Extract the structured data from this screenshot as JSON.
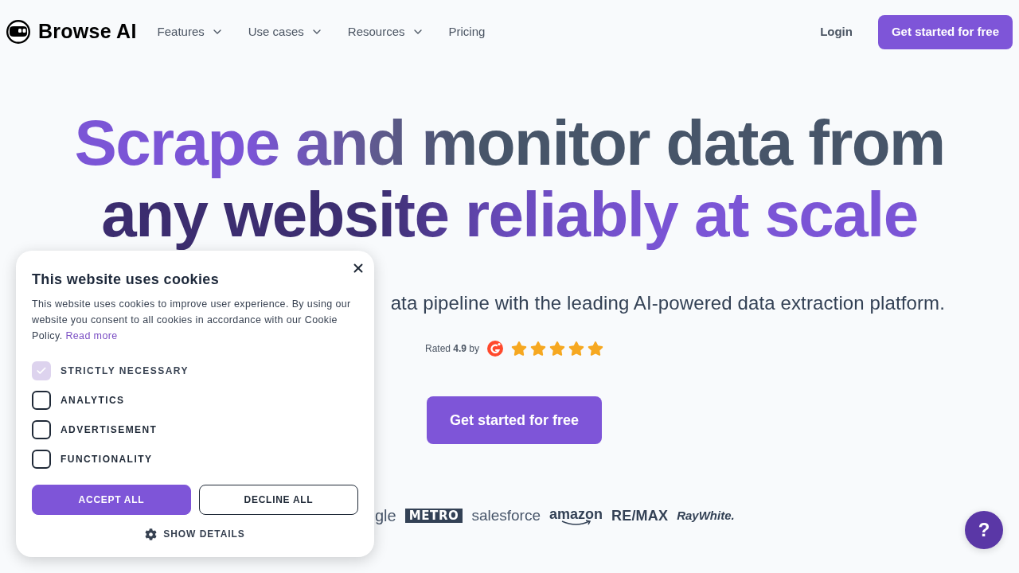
{
  "header": {
    "logo": {
      "text": "Browse AI"
    },
    "nav": [
      {
        "label": "Features",
        "dropdown": true
      },
      {
        "label": "Use cases",
        "dropdown": true
      },
      {
        "label": "Resources",
        "dropdown": true
      },
      {
        "label": "Pricing",
        "dropdown": false
      }
    ],
    "login": "Login",
    "cta": "Get started for free"
  },
  "hero": {
    "heading": "Scrape and monitor data from any website reliably at scale",
    "subtitle": "ata pipeline with the leading AI-powered data extraction platform.",
    "rating": {
      "text": "Rated **4.9** by",
      "stars": 5
    },
    "cta": "Get started for free",
    "logos": [
      {
        "kind": "plain",
        "text": "gle"
      },
      {
        "kind": "boxed",
        "text": "METRO"
      },
      {
        "kind": "light",
        "text": "salesforce"
      },
      {
        "kind": "smile",
        "text": "amazon"
      },
      {
        "kind": "bold",
        "text": "RE/MAX"
      },
      {
        "kind": "italic",
        "text": "RayWhite."
      }
    ]
  },
  "cookie_banner": {
    "title": "This website uses cookies",
    "body": "This website uses cookies to improve user experience. By using our website you consent to all cookies in accordance with our Cookie Policy.",
    "link": "Read more",
    "options": [
      {
        "label": "STRICTLY NECESSARY",
        "checked": true,
        "disabled": true
      },
      {
        "label": "ANALYTICS",
        "checked": false,
        "disabled": false
      },
      {
        "label": "ADVERTISEMENT",
        "checked": false,
        "disabled": false
      },
      {
        "label": "FUNCTIONALITY",
        "checked": false,
        "disabled": false
      }
    ],
    "buttons": [
      {
        "label": "ACCEPT ALL",
        "kind": "primary"
      },
      {
        "label": "DECLINE ALL",
        "kind": "outline"
      }
    ],
    "details": "SHOW DETAILS"
  },
  "help_button": {
    "label": "?"
  }
}
